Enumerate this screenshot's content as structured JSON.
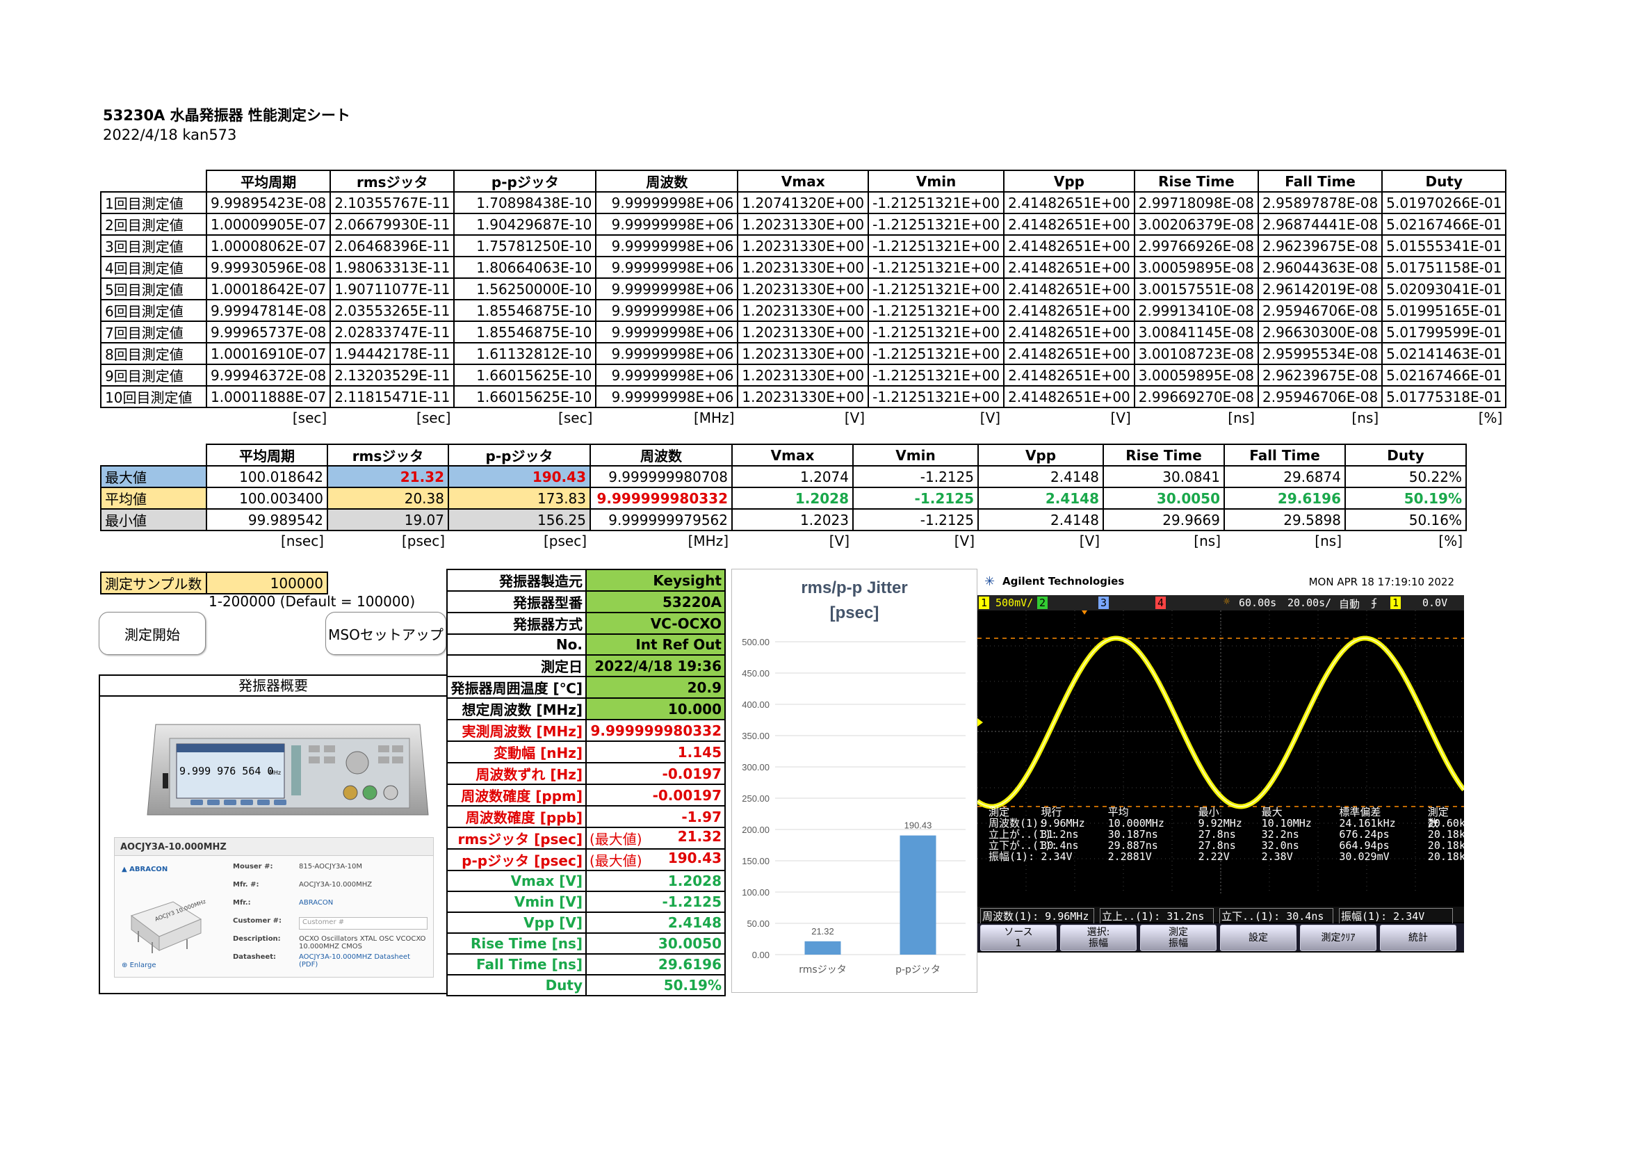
{
  "title": "53230A 水晶発振器 性能測定シート",
  "subtitle": "2022/4/18 kan573",
  "table1": {
    "headers": [
      "平均周期",
      "rmsジッタ",
      "p-pジッタ",
      "周波数",
      "Vmax",
      "Vmin",
      "Vpp",
      "Rise Time",
      "Fall Time",
      "Duty"
    ],
    "rows": [
      {
        "label": "1回目測定値",
        "values": [
          "9.99895423E-08",
          "2.10355767E-11",
          "1.70898438E-10",
          "9.99999998E+06",
          "1.20741320E+00",
          "-1.21251321E+00",
          "2.41482651E+00",
          "2.99718098E-08",
          "2.95897878E-08",
          "5.01970266E-01"
        ]
      },
      {
        "label": "2回目測定値",
        "values": [
          "1.00009905E-07",
          "2.06679930E-11",
          "1.90429687E-10",
          "9.99999998E+06",
          "1.20231330E+00",
          "-1.21251321E+00",
          "2.41482651E+00",
          "3.00206379E-08",
          "2.96874441E-08",
          "5.02167466E-01"
        ]
      },
      {
        "label": "3回目測定値",
        "values": [
          "1.00008062E-07",
          "2.06468396E-11",
          "1.75781250E-10",
          "9.99999998E+06",
          "1.20231330E+00",
          "-1.21251321E+00",
          "2.41482651E+00",
          "2.99766926E-08",
          "2.96239675E-08",
          "5.01555341E-01"
        ]
      },
      {
        "label": "4回目測定値",
        "values": [
          "9.99930596E-08",
          "1.98063313E-11",
          "1.80664063E-10",
          "9.99999998E+06",
          "1.20231330E+00",
          "-1.21251321E+00",
          "2.41482651E+00",
          "3.00059895E-08",
          "2.96044363E-08",
          "5.01751158E-01"
        ]
      },
      {
        "label": "5回目測定値",
        "values": [
          "1.00018642E-07",
          "1.90711077E-11",
          "1.56250000E-10",
          "9.99999998E+06",
          "1.20231330E+00",
          "-1.21251321E+00",
          "2.41482651E+00",
          "3.00157551E-08",
          "2.96142019E-08",
          "5.02093041E-01"
        ]
      },
      {
        "label": "6回目測定値",
        "values": [
          "9.99947814E-08",
          "2.03553265E-11",
          "1.85546875E-10",
          "9.99999998E+06",
          "1.20231330E+00",
          "-1.21251321E+00",
          "2.41482651E+00",
          "2.99913410E-08",
          "2.95946706E-08",
          "5.01995165E-01"
        ]
      },
      {
        "label": "7回目測定値",
        "values": [
          "9.99965737E-08",
          "2.02833747E-11",
          "1.85546875E-10",
          "9.99999998E+06",
          "1.20231330E+00",
          "-1.21251321E+00",
          "2.41482651E+00",
          "3.00841145E-08",
          "2.96630300E-08",
          "5.01799599E-01"
        ]
      },
      {
        "label": "8回目測定値",
        "values": [
          "1.00016910E-07",
          "1.94442178E-11",
          "1.61132812E-10",
          "9.99999998E+06",
          "1.20231330E+00",
          "-1.21251321E+00",
          "2.41482651E+00",
          "3.00108723E-08",
          "2.95995534E-08",
          "5.02141463E-01"
        ]
      },
      {
        "label": "9回目測定値",
        "values": [
          "9.99946372E-08",
          "2.13203529E-11",
          "1.66015625E-10",
          "9.99999998E+06",
          "1.20231330E+00",
          "-1.21251321E+00",
          "2.41482651E+00",
          "3.00059895E-08",
          "2.96239675E-08",
          "5.02167466E-01"
        ]
      },
      {
        "label": "10回目測定値",
        "values": [
          "1.00011888E-07",
          "2.11815471E-11",
          "1.66015625E-10",
          "9.99999998E+06",
          "1.20231330E+00",
          "-1.21251321E+00",
          "2.41482651E+00",
          "2.99669270E-08",
          "2.95946706E-08",
          "5.01775318E-01"
        ]
      }
    ],
    "units": [
      "[sec]",
      "[sec]",
      "[sec]",
      "[MHz]",
      "[V]",
      "[V]",
      "[V]",
      "[ns]",
      "[ns]",
      "[%]"
    ]
  },
  "table2": {
    "headers": [
      "平均周期",
      "rmsジッタ",
      "p-pジッタ",
      "周波数",
      "Vmax",
      "Vmin",
      "Vpp",
      "Rise Time",
      "Fall Time",
      "Duty"
    ],
    "max": {
      "label": "最大値",
      "values": [
        "100.018642",
        "21.32",
        "190.43",
        "9.999999980708",
        "1.2074",
        "-1.2125",
        "2.4148",
        "30.0841",
        "29.6874",
        "50.22%"
      ]
    },
    "avg": {
      "label": "平均値",
      "values": [
        "100.003400",
        "20.38",
        "173.83",
        "9.999999980332",
        "1.2028",
        "-1.2125",
        "2.4148",
        "30.0050",
        "29.6196",
        "50.19%"
      ]
    },
    "min": {
      "label": "最小値",
      "values": [
        "99.989542",
        "19.07",
        "156.25",
        "9.999999979562",
        "1.2023",
        "-1.2125",
        "2.4148",
        "29.9669",
        "29.5898",
        "50.16%"
      ]
    },
    "units": [
      "[nsec]",
      "[psec]",
      "[psec]",
      "[MHz]",
      "[V]",
      "[V]",
      "[V]",
      "[ns]",
      "[ns]",
      "[%]"
    ]
  },
  "sample": {
    "label": "測定サンプル数",
    "value": "100000",
    "range": "1-200000 (Default = 100000)"
  },
  "buttons": {
    "start": "測定開始",
    "mso": "MSOセットアップ"
  },
  "overview_title": "発振器概要",
  "product": {
    "part": "AOCJY3A-10.000MHZ",
    "brand": "ABRACON",
    "fields": [
      {
        "k": "Mouser #:",
        "v": "815-AOCJY3A-10M"
      },
      {
        "k": "Mfr. #:",
        "v": "AOCJY3A-10.000MHZ"
      },
      {
        "k": "Mfr.:",
        "v": "ABRACON"
      },
      {
        "k": "Customer #:",
        "v": "Customer #"
      },
      {
        "k": "Description:",
        "v": "OCXO Oscillators XTAL OSC VCOCXO 10.000MHZ CMOS"
      },
      {
        "k": "Datasheet:",
        "v": "AOCJY3A-10.000MHZ Datasheet (PDF)"
      }
    ],
    "enlarge": "Enlarge",
    "device_reading": "9.999 976 564 0",
    "device_unit": "MHz",
    "chip_text": "AOCJY3 10.000MHz"
  },
  "info": [
    {
      "k": "発振器製造元",
      "v": "Keysight",
      "style": "green-bg"
    },
    {
      "k": "発振器型番",
      "v": "53220A",
      "style": "green-bg"
    },
    {
      "k": "発振器方式",
      "v": "VC-OCXO",
      "style": "green-bg"
    },
    {
      "k": "No.",
      "v": "Int Ref Out",
      "style": "green-bg"
    },
    {
      "k": "測定日",
      "v": "2022/4/18 19:36",
      "style": "green-bg"
    },
    {
      "k": "発振器周囲温度 [℃]",
      "v": "20.9",
      "style": "green-bg"
    },
    {
      "k": "想定周波数 [MHz]",
      "v": "10.000",
      "style": "green-bg"
    },
    {
      "k": "実測周波数 [MHz]",
      "v": "9.999999980332",
      "style": "red"
    },
    {
      "k": "変動幅 [nHz]",
      "v": "1.145",
      "style": "red"
    },
    {
      "k": "周波数ずれ [Hz]",
      "v": "-0.0197",
      "style": "red"
    },
    {
      "k": "周波数確度 [ppm]",
      "v": "-0.00197",
      "style": "red"
    },
    {
      "k": "周波数確度 [ppb]",
      "v": "-1.97",
      "style": "red"
    },
    {
      "k": "rmsジッタ [psec]",
      "v": "21.32",
      "note": "(最大値)",
      "style": "red"
    },
    {
      "k": "p-pジッタ [psec]",
      "v": "190.43",
      "note": "(最大値)",
      "style": "red"
    },
    {
      "k": "Vmax [V]",
      "v": "1.2028",
      "style": "green"
    },
    {
      "k": "Vmin [V]",
      "v": "-1.2125",
      "style": "green"
    },
    {
      "k": "Vpp [V]",
      "v": "2.4148",
      "style": "green"
    },
    {
      "k": "Rise Time [ns]",
      "v": "30.0050",
      "style": "green"
    },
    {
      "k": "Fall Time [ns]",
      "v": "29.6196",
      "style": "green"
    },
    {
      "k": "Duty",
      "v": "50.19%",
      "style": "green"
    }
  ],
  "chart_data": {
    "type": "bar",
    "title": "rms/p-p Jitter",
    "subtitle": "[psec]",
    "categories": [
      "rmsジッタ",
      "p-pジッタ"
    ],
    "values": [
      21.32,
      190.43
    ],
    "value_labels": [
      "21.32",
      "190.43"
    ],
    "ylim": [
      0,
      500
    ],
    "yticks": [
      "0.00",
      "50.00",
      "100.00",
      "150.00",
      "200.00",
      "250.00",
      "300.00",
      "350.00",
      "400.00",
      "450.00",
      "500.00"
    ],
    "grid": true,
    "color": "#5b9bd5"
  },
  "scope": {
    "brand": "Agilent Technologies",
    "datetime": "MON APR 18 17:19:10 2022",
    "ch1_scale": "500mV/",
    "ch_nums": [
      "1",
      "2",
      "3",
      "4"
    ],
    "time_delay": "60.00s",
    "time_scale": "20.00s/",
    "trig_mode": "自動",
    "trig_level": "0.0V",
    "stats_header": [
      "測定",
      "現行",
      "平均",
      "最小",
      "最大",
      "標準偏差",
      "測定数"
    ],
    "stats_rows": [
      [
        "周波数(1):",
        "9.96MHz",
        "10.000MHz",
        "9.92MHz",
        "10.10MHz",
        "24.161kHz",
        "20.60k"
      ],
      [
        "立上が..(1):",
        "31.2ns",
        "30.187ns",
        "27.8ns",
        "32.2ns",
        "676.24ps",
        "20.18k"
      ],
      [
        "立下が..(1):",
        "30.4ns",
        "29.887ns",
        "27.8ns",
        "32.0ns",
        "664.94ps",
        "20.18k"
      ],
      [
        "振幅(1):",
        "2.34V",
        "2.2881V",
        "2.22V",
        "2.38V",
        "30.029mV",
        "20.18k"
      ]
    ],
    "bottom_readouts": [
      "周波数(1): 9.96MHz",
      "立上..(1): 31.2ns",
      "立下..(1): 30.4ns",
      "振幅(1): 2.34V"
    ],
    "softkeys": [
      "ソース\n1",
      "選択:\n振幅",
      "測定\n振幅",
      "設定",
      "測定ｸﾘｱ",
      "統計"
    ]
  }
}
